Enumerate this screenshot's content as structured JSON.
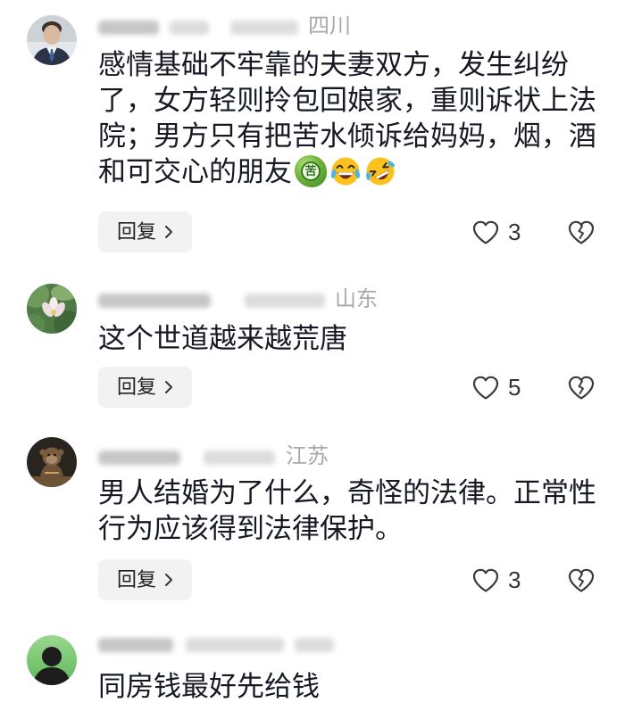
{
  "colors": {
    "background": "#ffffff",
    "text": "#161823",
    "meta": "#a9a9a9",
    "reply_background": "#f2f2f2",
    "icon": "#3a3a3a"
  },
  "icons": {
    "like": "heart-outline-icon",
    "dislike": "broken-heart-icon",
    "reply_chevron": "chevron-right-icon"
  },
  "comments": [
    {
      "avatar_icon": "man-in-suit-avatar",
      "location": "四川",
      "text": "感情基础不牢靠的夫妻双方，发生纠纷了，女方轻则拎包回娘家，重则诉状上法院；男方只有把苦水倾诉给妈妈，烟，酒和可交心的朋友",
      "emojis": [
        {
          "icon": "bitter-melon-emoji",
          "text": "苦"
        },
        {
          "icon": "tears-of-joy-emoji"
        },
        {
          "icon": "rolling-on-floor-laughing-emoji"
        }
      ],
      "reply_label": "回复",
      "like_count": "3"
    },
    {
      "avatar_icon": "lotus-avatar",
      "location": "山东",
      "text": "这个世道越来越荒唐",
      "reply_label": "回复",
      "like_count": "5"
    },
    {
      "avatar_icon": "figurine-avatar",
      "location": "江苏",
      "text": "男人结婚为了什么，奇怪的法律。正常性行为应该得到法律保护。",
      "reply_label": "回复",
      "like_count": "3"
    },
    {
      "avatar_icon": "silhouette-avatar",
      "text": "同房钱最好先给钱"
    }
  ]
}
